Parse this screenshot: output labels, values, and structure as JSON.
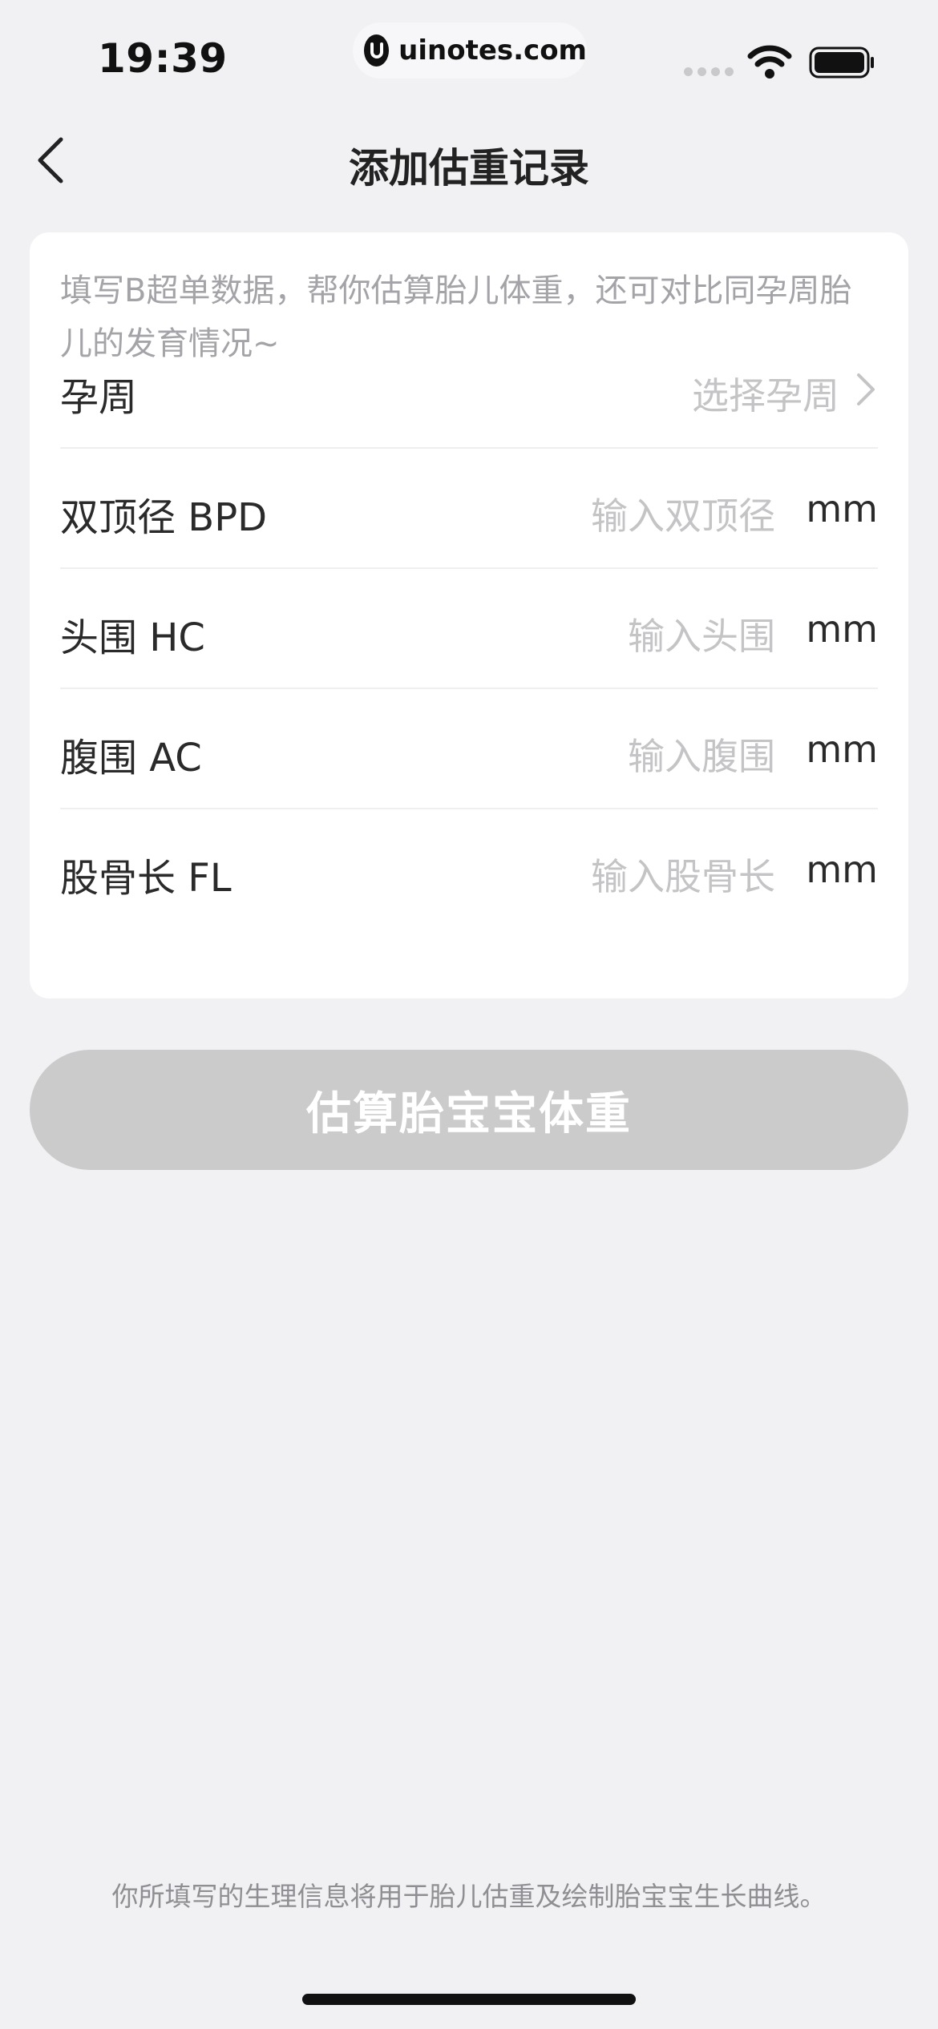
{
  "status_bar": {
    "time": "19:39",
    "url": "uinotes.com",
    "icons": [
      "signal-dots-icon",
      "wifi-icon",
      "battery-icon"
    ]
  },
  "nav": {
    "back_icon": "chevron-left-icon",
    "title": "添加估重记录"
  },
  "form": {
    "intro": "填写B超单数据，帮你估算胎儿体重，还可对比同孕周胎儿的发育情况~",
    "rows": [
      {
        "label": "孕周",
        "placeholder": "选择孕周",
        "type": "select",
        "icon": "chevron-right-icon"
      },
      {
        "label": "双顶径 BPD",
        "placeholder": "输入双顶径",
        "unit": "mm"
      },
      {
        "label": "头围 HC",
        "placeholder": "输入头围",
        "unit": "mm"
      },
      {
        "label": "腹围 AC",
        "placeholder": "输入腹围",
        "unit": "mm"
      },
      {
        "label": "股骨长 FL",
        "placeholder": "输入股骨长",
        "unit": "mm"
      }
    ]
  },
  "primary_button": {
    "label": "估算胎宝宝体重",
    "state": "disabled",
    "color": "#cbcbcb"
  },
  "footer": {
    "note": "你所填写的生理信息将用于胎儿估重及绘制胎宝宝生长曲线。"
  },
  "colors": {
    "background": "#f1f1f3",
    "card": "#ffffff",
    "placeholder": "#c4c4c6",
    "text": "#2a2a2a"
  }
}
